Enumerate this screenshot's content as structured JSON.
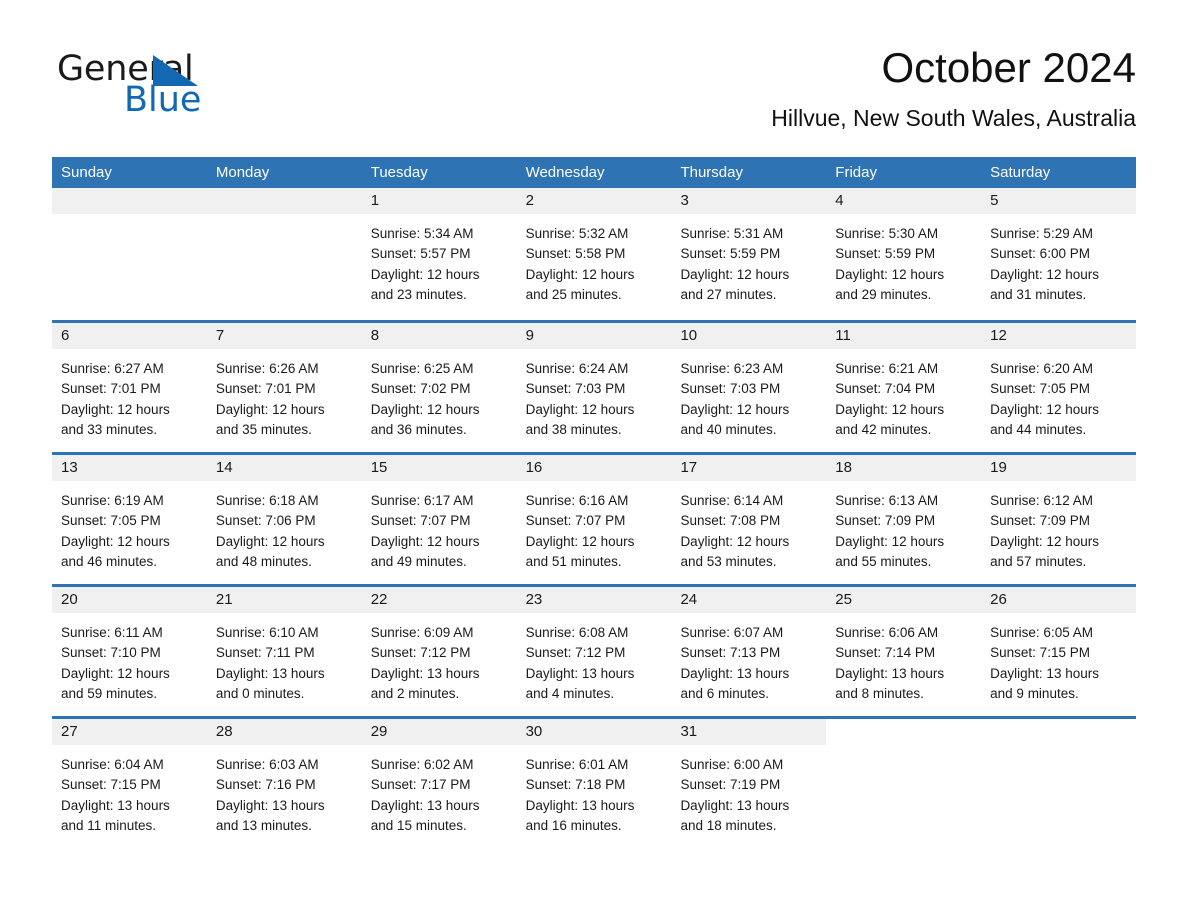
{
  "brand": {
    "line1": "General",
    "line2": "Blue",
    "triangle_color": "#1268b3"
  },
  "header": {
    "month_title": "October 2024",
    "location": "Hillvue, New South Wales, Australia"
  },
  "theme": {
    "header_blue": "#2e73b4",
    "day_band_gray": "#f0f0f0",
    "text_black": "#1a1a1a"
  },
  "weekdays": [
    "Sunday",
    "Monday",
    "Tuesday",
    "Wednesday",
    "Thursday",
    "Friday",
    "Saturday"
  ],
  "weeks": [
    [
      {
        "day": "",
        "sunrise": "",
        "sunset": "",
        "daylight1": "",
        "daylight2": "",
        "empty": true
      },
      {
        "day": "",
        "sunrise": "",
        "sunset": "",
        "daylight1": "",
        "daylight2": "",
        "empty": true
      },
      {
        "day": "1",
        "sunrise": "Sunrise: 5:34 AM",
        "sunset": "Sunset: 5:57 PM",
        "daylight1": "Daylight: 12 hours",
        "daylight2": "and 23 minutes."
      },
      {
        "day": "2",
        "sunrise": "Sunrise: 5:32 AM",
        "sunset": "Sunset: 5:58 PM",
        "daylight1": "Daylight: 12 hours",
        "daylight2": "and 25 minutes."
      },
      {
        "day": "3",
        "sunrise": "Sunrise: 5:31 AM",
        "sunset": "Sunset: 5:59 PM",
        "daylight1": "Daylight: 12 hours",
        "daylight2": "and 27 minutes."
      },
      {
        "day": "4",
        "sunrise": "Sunrise: 5:30 AM",
        "sunset": "Sunset: 5:59 PM",
        "daylight1": "Daylight: 12 hours",
        "daylight2": "and 29 minutes."
      },
      {
        "day": "5",
        "sunrise": "Sunrise: 5:29 AM",
        "sunset": "Sunset: 6:00 PM",
        "daylight1": "Daylight: 12 hours",
        "daylight2": "and 31 minutes."
      }
    ],
    [
      {
        "day": "6",
        "sunrise": "Sunrise: 6:27 AM",
        "sunset": "Sunset: 7:01 PM",
        "daylight1": "Daylight: 12 hours",
        "daylight2": "and 33 minutes."
      },
      {
        "day": "7",
        "sunrise": "Sunrise: 6:26 AM",
        "sunset": "Sunset: 7:01 PM",
        "daylight1": "Daylight: 12 hours",
        "daylight2": "and 35 minutes."
      },
      {
        "day": "8",
        "sunrise": "Sunrise: 6:25 AM",
        "sunset": "Sunset: 7:02 PM",
        "daylight1": "Daylight: 12 hours",
        "daylight2": "and 36 minutes."
      },
      {
        "day": "9",
        "sunrise": "Sunrise: 6:24 AM",
        "sunset": "Sunset: 7:03 PM",
        "daylight1": "Daylight: 12 hours",
        "daylight2": "and 38 minutes."
      },
      {
        "day": "10",
        "sunrise": "Sunrise: 6:23 AM",
        "sunset": "Sunset: 7:03 PM",
        "daylight1": "Daylight: 12 hours",
        "daylight2": "and 40 minutes."
      },
      {
        "day": "11",
        "sunrise": "Sunrise: 6:21 AM",
        "sunset": "Sunset: 7:04 PM",
        "daylight1": "Daylight: 12 hours",
        "daylight2": "and 42 minutes."
      },
      {
        "day": "12",
        "sunrise": "Sunrise: 6:20 AM",
        "sunset": "Sunset: 7:05 PM",
        "daylight1": "Daylight: 12 hours",
        "daylight2": "and 44 minutes."
      }
    ],
    [
      {
        "day": "13",
        "sunrise": "Sunrise: 6:19 AM",
        "sunset": "Sunset: 7:05 PM",
        "daylight1": "Daylight: 12 hours",
        "daylight2": "and 46 minutes."
      },
      {
        "day": "14",
        "sunrise": "Sunrise: 6:18 AM",
        "sunset": "Sunset: 7:06 PM",
        "daylight1": "Daylight: 12 hours",
        "daylight2": "and 48 minutes."
      },
      {
        "day": "15",
        "sunrise": "Sunrise: 6:17 AM",
        "sunset": "Sunset: 7:07 PM",
        "daylight1": "Daylight: 12 hours",
        "daylight2": "and 49 minutes."
      },
      {
        "day": "16",
        "sunrise": "Sunrise: 6:16 AM",
        "sunset": "Sunset: 7:07 PM",
        "daylight1": "Daylight: 12 hours",
        "daylight2": "and 51 minutes."
      },
      {
        "day": "17",
        "sunrise": "Sunrise: 6:14 AM",
        "sunset": "Sunset: 7:08 PM",
        "daylight1": "Daylight: 12 hours",
        "daylight2": "and 53 minutes."
      },
      {
        "day": "18",
        "sunrise": "Sunrise: 6:13 AM",
        "sunset": "Sunset: 7:09 PM",
        "daylight1": "Daylight: 12 hours",
        "daylight2": "and 55 minutes."
      },
      {
        "day": "19",
        "sunrise": "Sunrise: 6:12 AM",
        "sunset": "Sunset: 7:09 PM",
        "daylight1": "Daylight: 12 hours",
        "daylight2": "and 57 minutes."
      }
    ],
    [
      {
        "day": "20",
        "sunrise": "Sunrise: 6:11 AM",
        "sunset": "Sunset: 7:10 PM",
        "daylight1": "Daylight: 12 hours",
        "daylight2": "and 59 minutes."
      },
      {
        "day": "21",
        "sunrise": "Sunrise: 6:10 AM",
        "sunset": "Sunset: 7:11 PM",
        "daylight1": "Daylight: 13 hours",
        "daylight2": "and 0 minutes."
      },
      {
        "day": "22",
        "sunrise": "Sunrise: 6:09 AM",
        "sunset": "Sunset: 7:12 PM",
        "daylight1": "Daylight: 13 hours",
        "daylight2": "and 2 minutes."
      },
      {
        "day": "23",
        "sunrise": "Sunrise: 6:08 AM",
        "sunset": "Sunset: 7:12 PM",
        "daylight1": "Daylight: 13 hours",
        "daylight2": "and 4 minutes."
      },
      {
        "day": "24",
        "sunrise": "Sunrise: 6:07 AM",
        "sunset": "Sunset: 7:13 PM",
        "daylight1": "Daylight: 13 hours",
        "daylight2": "and 6 minutes."
      },
      {
        "day": "25",
        "sunrise": "Sunrise: 6:06 AM",
        "sunset": "Sunset: 7:14 PM",
        "daylight1": "Daylight: 13 hours",
        "daylight2": "and 8 minutes."
      },
      {
        "day": "26",
        "sunrise": "Sunrise: 6:05 AM",
        "sunset": "Sunset: 7:15 PM",
        "daylight1": "Daylight: 13 hours",
        "daylight2": "and 9 minutes."
      }
    ],
    [
      {
        "day": "27",
        "sunrise": "Sunrise: 6:04 AM",
        "sunset": "Sunset: 7:15 PM",
        "daylight1": "Daylight: 13 hours",
        "daylight2": "and 11 minutes."
      },
      {
        "day": "28",
        "sunrise": "Sunrise: 6:03 AM",
        "sunset": "Sunset: 7:16 PM",
        "daylight1": "Daylight: 13 hours",
        "daylight2": "and 13 minutes."
      },
      {
        "day": "29",
        "sunrise": "Sunrise: 6:02 AM",
        "sunset": "Sunset: 7:17 PM",
        "daylight1": "Daylight: 13 hours",
        "daylight2": "and 15 minutes."
      },
      {
        "day": "30",
        "sunrise": "Sunrise: 6:01 AM",
        "sunset": "Sunset: 7:18 PM",
        "daylight1": "Daylight: 13 hours",
        "daylight2": "and 16 minutes."
      },
      {
        "day": "31",
        "sunrise": "Sunrise: 6:00 AM",
        "sunset": "Sunset: 7:19 PM",
        "daylight1": "Daylight: 13 hours",
        "daylight2": "and 18 minutes."
      },
      {
        "day": "",
        "sunrise": "",
        "sunset": "",
        "daylight1": "",
        "daylight2": "",
        "empty": true,
        "nofill": true
      },
      {
        "day": "",
        "sunrise": "",
        "sunset": "",
        "daylight1": "",
        "daylight2": "",
        "empty": true,
        "nofill": true
      }
    ]
  ]
}
